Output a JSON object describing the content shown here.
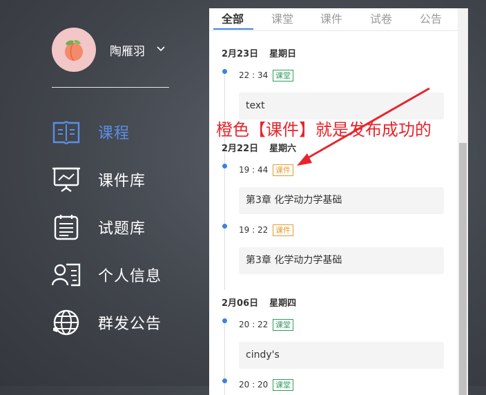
{
  "user": {
    "name": "陶雁羽"
  },
  "nav": [
    {
      "label": "课程",
      "icon": "book-icon",
      "active": true
    },
    {
      "label": "课件库",
      "icon": "presentation-icon",
      "active": false
    },
    {
      "label": "试题库",
      "icon": "clipboard-icon",
      "active": false
    },
    {
      "label": "个人信息",
      "icon": "id-card-icon",
      "active": false
    },
    {
      "label": "群发公告",
      "icon": "globe-icon",
      "active": false
    }
  ],
  "tabs": [
    "全部",
    "课堂",
    "课件",
    "试卷",
    "公告"
  ],
  "groups": [
    {
      "date": "2月23日",
      "weekday": "星期日",
      "items": [
        {
          "time": "22 : 34",
          "tag": "课堂",
          "tag_color": "#2e9b5c",
          "title": "text"
        }
      ]
    },
    {
      "date": "2月22日",
      "weekday": "星期六",
      "items": [
        {
          "time": "19 : 44",
          "tag": "课件",
          "tag_color": "#e39a2e",
          "title": "第3章 化学动力学基础"
        },
        {
          "time": "19 : 22",
          "tag": "课件",
          "tag_color": "#e39a2e",
          "title": "第3章 化学动力学基础"
        }
      ]
    },
    {
      "date": "2月06日",
      "weekday": "星期四",
      "items": [
        {
          "time": "20 : 22",
          "tag": "课堂",
          "tag_color": "#2e9b5c",
          "title": "cindy's"
        },
        {
          "time": "20 : 20",
          "tag": "课堂",
          "tag_color": "#2e9b5c",
          "title": ""
        }
      ]
    }
  ],
  "annotation": {
    "text": "橙色【课件】就是发布成功的",
    "color": "#e8242b"
  },
  "colors": {
    "accent": "#3b82e0",
    "nav_active": "#5b8fe6"
  }
}
